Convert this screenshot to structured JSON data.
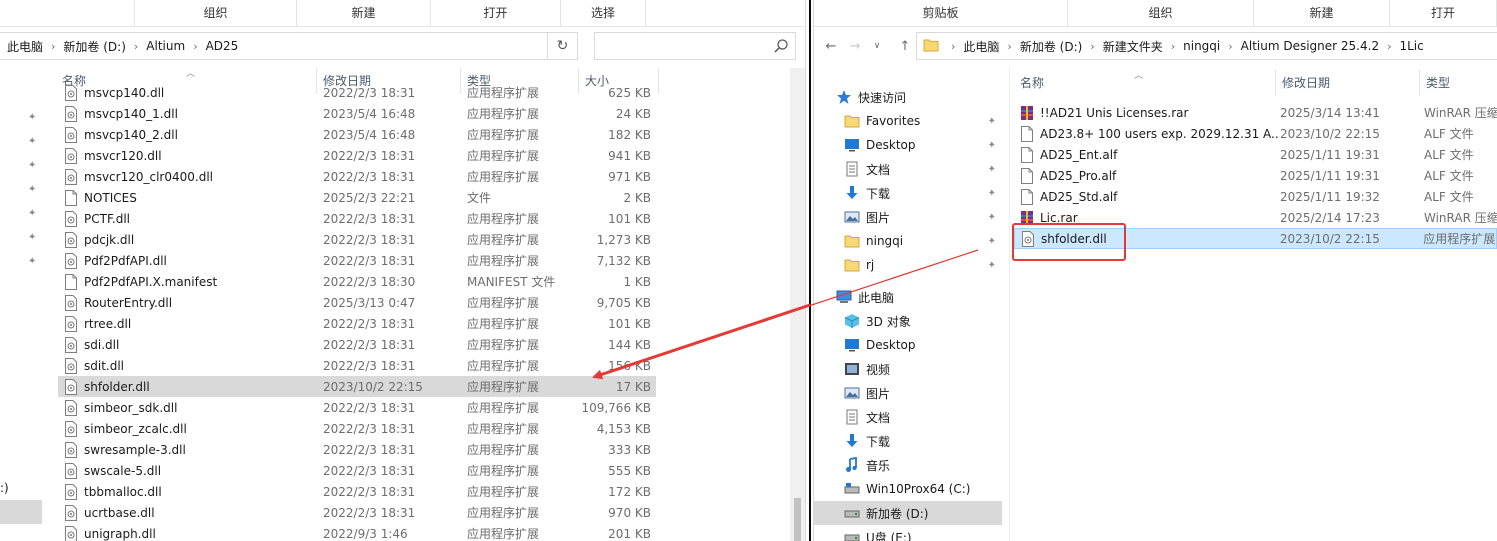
{
  "left": {
    "ribbon": [
      "组织",
      "新建",
      "打开",
      "选择"
    ],
    "breadcrumb": [
      "此电脑",
      "新加卷 (D:)",
      "Altium",
      "AD25"
    ],
    "search_placeholder": "",
    "columns": {
      "name": "名称",
      "date": "修改日期",
      "type": "类型",
      "size": "大小"
    },
    "files": [
      {
        "name": "msvcp140.dll",
        "date": "2022/2/3 18:31",
        "type": "应用程序扩展",
        "size": "625 KB",
        "icon": "dll"
      },
      {
        "name": "msvcp140_1.dll",
        "date": "2023/5/4 16:48",
        "type": "应用程序扩展",
        "size": "24 KB",
        "icon": "dll"
      },
      {
        "name": "msvcp140_2.dll",
        "date": "2023/5/4 16:48",
        "type": "应用程序扩展",
        "size": "182 KB",
        "icon": "dll"
      },
      {
        "name": "msvcr120.dll",
        "date": "2022/2/3 18:31",
        "type": "应用程序扩展",
        "size": "941 KB",
        "icon": "dll"
      },
      {
        "name": "msvcr120_clr0400.dll",
        "date": "2022/2/3 18:31",
        "type": "应用程序扩展",
        "size": "971 KB",
        "icon": "dll"
      },
      {
        "name": "NOTICES",
        "date": "2025/2/3 22:21",
        "type": "文件",
        "size": "2 KB",
        "icon": "file"
      },
      {
        "name": "PCTF.dll",
        "date": "2022/2/3 18:31",
        "type": "应用程序扩展",
        "size": "101 KB",
        "icon": "dll"
      },
      {
        "name": "pdcjk.dll",
        "date": "2022/2/3 18:31",
        "type": "应用程序扩展",
        "size": "1,273 KB",
        "icon": "dll"
      },
      {
        "name": "Pdf2PdfAPI.dll",
        "date": "2022/2/3 18:31",
        "type": "应用程序扩展",
        "size": "7,132 KB",
        "icon": "dll"
      },
      {
        "name": "Pdf2PdfAPI.X.manifest",
        "date": "2022/2/3 18:30",
        "type": "MANIFEST 文件",
        "size": "1 KB",
        "icon": "file"
      },
      {
        "name": "RouterEntry.dll",
        "date": "2025/3/13 0:47",
        "type": "应用程序扩展",
        "size": "9,705 KB",
        "icon": "dll"
      },
      {
        "name": "rtree.dll",
        "date": "2022/2/3 18:31",
        "type": "应用程序扩展",
        "size": "101 KB",
        "icon": "dll"
      },
      {
        "name": "sdi.dll",
        "date": "2022/2/3 18:31",
        "type": "应用程序扩展",
        "size": "144 KB",
        "icon": "dll"
      },
      {
        "name": "sdit.dll",
        "date": "2022/2/3 18:31",
        "type": "应用程序扩展",
        "size": "156 KB",
        "icon": "dll"
      },
      {
        "name": "shfolder.dll",
        "date": "2023/10/2 22:15",
        "type": "应用程序扩展",
        "size": "17 KB",
        "icon": "dll",
        "selected": true
      },
      {
        "name": "simbeor_sdk.dll",
        "date": "2022/2/3 18:31",
        "type": "应用程序扩展",
        "size": "109,766 KB",
        "icon": "dll"
      },
      {
        "name": "simbeor_zcalc.dll",
        "date": "2022/2/3 18:31",
        "type": "应用程序扩展",
        "size": "4,153 KB",
        "icon": "dll"
      },
      {
        "name": "swresample-3.dll",
        "date": "2022/2/3 18:31",
        "type": "应用程序扩展",
        "size": "333 KB",
        "icon": "dll"
      },
      {
        "name": "swscale-5.dll",
        "date": "2022/2/3 18:31",
        "type": "应用程序扩展",
        "size": "555 KB",
        "icon": "dll"
      },
      {
        "name": "tbbmalloc.dll",
        "date": "2022/2/3 18:31",
        "type": "应用程序扩展",
        "size": "172 KB",
        "icon": "dll"
      },
      {
        "name": "ucrtbase.dll",
        "date": "2022/2/3 18:31",
        "type": "应用程序扩展",
        "size": "970 KB",
        "icon": "dll"
      },
      {
        "name": "unigraph.dll",
        "date": "2022/9/3 1:46",
        "type": "应用程序扩展",
        "size": "201 KB",
        "icon": "dll"
      }
    ],
    "nav_fragment": ":)"
  },
  "right": {
    "ribbon": [
      "剪贴板",
      "组织",
      "新建",
      "打开"
    ],
    "breadcrumb": [
      "此电脑",
      "新加卷 (D:)",
      "新建文件夹",
      "ningqi",
      "Altium Designer 25.4.2",
      "1Lic"
    ],
    "columns": {
      "name": "名称",
      "date": "修改日期",
      "type": "类型"
    },
    "files": [
      {
        "name": "!!AD21 Unis Licenses.rar",
        "date": "2025/3/14 13:41",
        "type": "WinRAR 压缩",
        "icon": "rar"
      },
      {
        "name": "AD23.8+ 100 users exp. 2029.12.31 A...",
        "date": "2023/10/2 22:15",
        "type": "ALF 文件",
        "icon": "file"
      },
      {
        "name": "AD25_Ent.alf",
        "date": "2025/1/11 19:31",
        "type": "ALF 文件",
        "icon": "file"
      },
      {
        "name": "AD25_Pro.alf",
        "date": "2025/1/11 19:31",
        "type": "ALF 文件",
        "icon": "file"
      },
      {
        "name": "AD25_Std.alf",
        "date": "2025/1/11 19:32",
        "type": "ALF 文件",
        "icon": "file"
      },
      {
        "name": "Lic.rar",
        "date": "2025/2/14 17:23",
        "type": "WinRAR 压缩",
        "icon": "rar"
      },
      {
        "name": "shfolder.dll",
        "date": "2023/10/2 22:15",
        "type": "应用程序扩展",
        "icon": "dll",
        "selected": true
      }
    ],
    "nav": [
      {
        "label": "快速访问",
        "icon": "star",
        "indent": 1,
        "pin": false
      },
      {
        "label": "Favorites",
        "icon": "folder",
        "indent": 2,
        "pin": true
      },
      {
        "label": "Desktop",
        "icon": "desktop",
        "indent": 2,
        "pin": true
      },
      {
        "label": "文档",
        "icon": "docs",
        "indent": 2,
        "pin": true
      },
      {
        "label": "下载",
        "icon": "download",
        "indent": 2,
        "pin": true
      },
      {
        "label": "图片",
        "icon": "pictures",
        "indent": 2,
        "pin": true
      },
      {
        "label": "ningqi",
        "icon": "folder",
        "indent": 2,
        "pin": true
      },
      {
        "label": "rj",
        "icon": "folder",
        "indent": 2,
        "pin": true
      },
      {
        "label": "此电脑",
        "icon": "pc",
        "indent": 1,
        "pin": false
      },
      {
        "label": "3D 对象",
        "icon": "3d",
        "indent": 2,
        "pin": false
      },
      {
        "label": "Desktop",
        "icon": "desktop",
        "indent": 2,
        "pin": false
      },
      {
        "label": "视频",
        "icon": "video",
        "indent": 2,
        "pin": false
      },
      {
        "label": "图片",
        "icon": "pictures",
        "indent": 2,
        "pin": false
      },
      {
        "label": "文档",
        "icon": "docs",
        "indent": 2,
        "pin": false
      },
      {
        "label": "下载",
        "icon": "download",
        "indent": 2,
        "pin": false
      },
      {
        "label": "音乐",
        "icon": "music",
        "indent": 2,
        "pin": false
      },
      {
        "label": "Win10Prox64 (C:)",
        "icon": "drive-c",
        "indent": 2,
        "pin": false
      },
      {
        "label": "新加卷 (D:)",
        "icon": "drive",
        "indent": 2,
        "pin": false,
        "selected": true
      },
      {
        "label": "U盘 (E:)",
        "icon": "drive",
        "indent": 2,
        "pin": false
      }
    ]
  },
  "colors": {
    "annotation": "#e53935",
    "selection_gray": "#d9d9d9",
    "selection_blue": "#cce8ff"
  }
}
